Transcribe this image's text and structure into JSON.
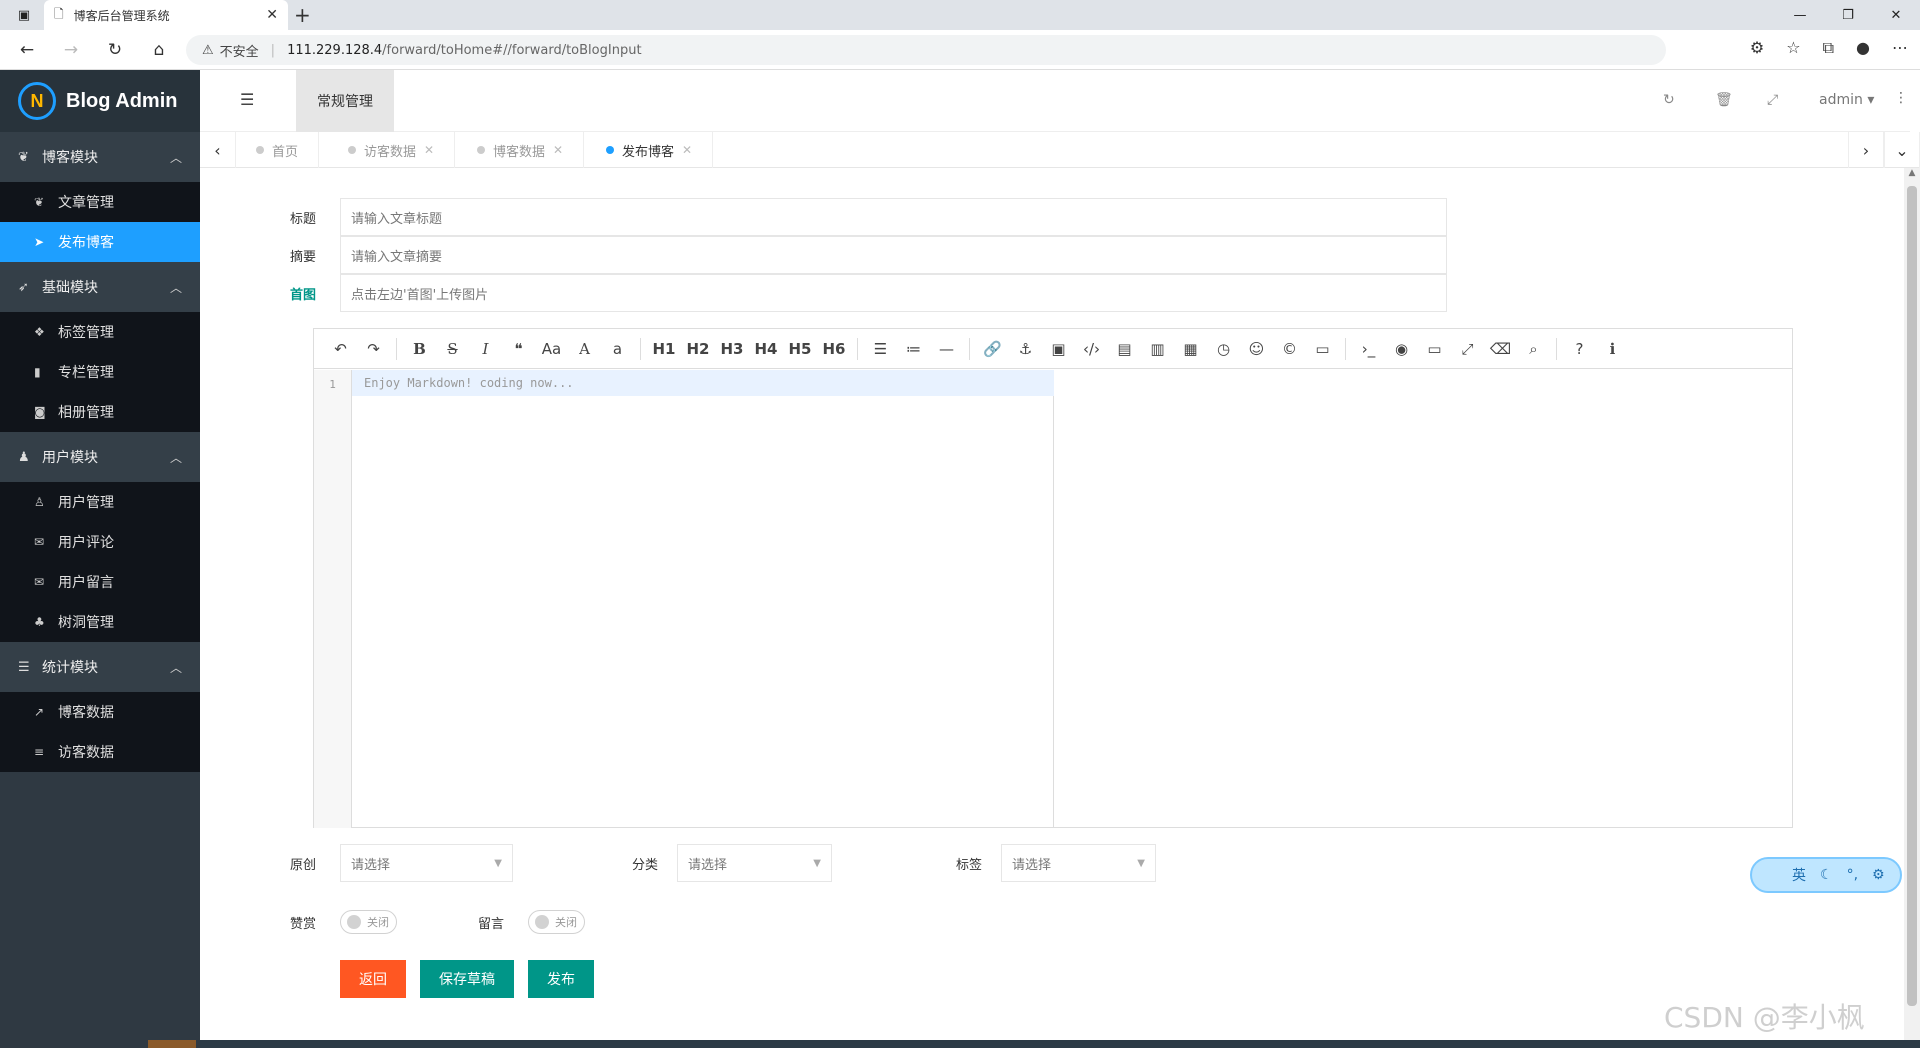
{
  "browser": {
    "tab_title": "博客后台管理系统",
    "not_secure": "不安全",
    "url_host": "111.229.128.4",
    "url_path": "/forward/toHome#//forward/toBlogInput"
  },
  "sidebar": {
    "brand": "Blog Admin",
    "groups": [
      {
        "label": "博客模块",
        "items": [
          {
            "label": "文章管理"
          },
          {
            "label": "发布博客"
          }
        ]
      },
      {
        "label": "基础模块",
        "items": [
          {
            "label": "标签管理"
          },
          {
            "label": "专栏管理"
          },
          {
            "label": "相册管理"
          }
        ]
      },
      {
        "label": "用户模块",
        "items": [
          {
            "label": "用户管理"
          },
          {
            "label": "用户评论"
          },
          {
            "label": "用户留言"
          },
          {
            "label": "树洞管理"
          }
        ]
      },
      {
        "label": "统计模块",
        "items": [
          {
            "label": "博客数据"
          },
          {
            "label": "访客数据"
          }
        ]
      }
    ]
  },
  "header": {
    "current": "常规管理",
    "user": "admin"
  },
  "tabs": [
    {
      "label": "首页"
    },
    {
      "label": "访客数据"
    },
    {
      "label": "博客数据"
    },
    {
      "label": "发布博客"
    }
  ],
  "form": {
    "title_label": "标题",
    "title_placeholder": "请输入文章标题",
    "summary_label": "摘要",
    "summary_placeholder": "请输入文章摘要",
    "cover_label": "首图",
    "cover_placeholder": "点击左边'首图'上传图片",
    "editor_line_no": "1",
    "editor_placeholder": "Enjoy Markdown! coding now...",
    "original_label": "原创",
    "category_label": "分类",
    "tag_label": "标签",
    "select_placeholder": "请选择",
    "reward_label": "赞赏",
    "comment_label": "留言",
    "switch_off": "关闭",
    "back_button": "返回",
    "save_draft_button": "保存草稿",
    "publish_button": "发布"
  },
  "toolbar": {
    "h1": "H1",
    "h2": "H2",
    "h3": "H3",
    "h4": "H4",
    "h5": "H5",
    "h6": "H6",
    "aa": "Aa",
    "a_upper": "A",
    "a_lower": "a"
  },
  "ime": {
    "mode": "英"
  },
  "watermark": "CSDN @李小枫",
  "colors": {
    "primary": "#1e9fff",
    "teal": "#009688",
    "orange": "#ff5722",
    "sidebar": "#2f3942"
  }
}
